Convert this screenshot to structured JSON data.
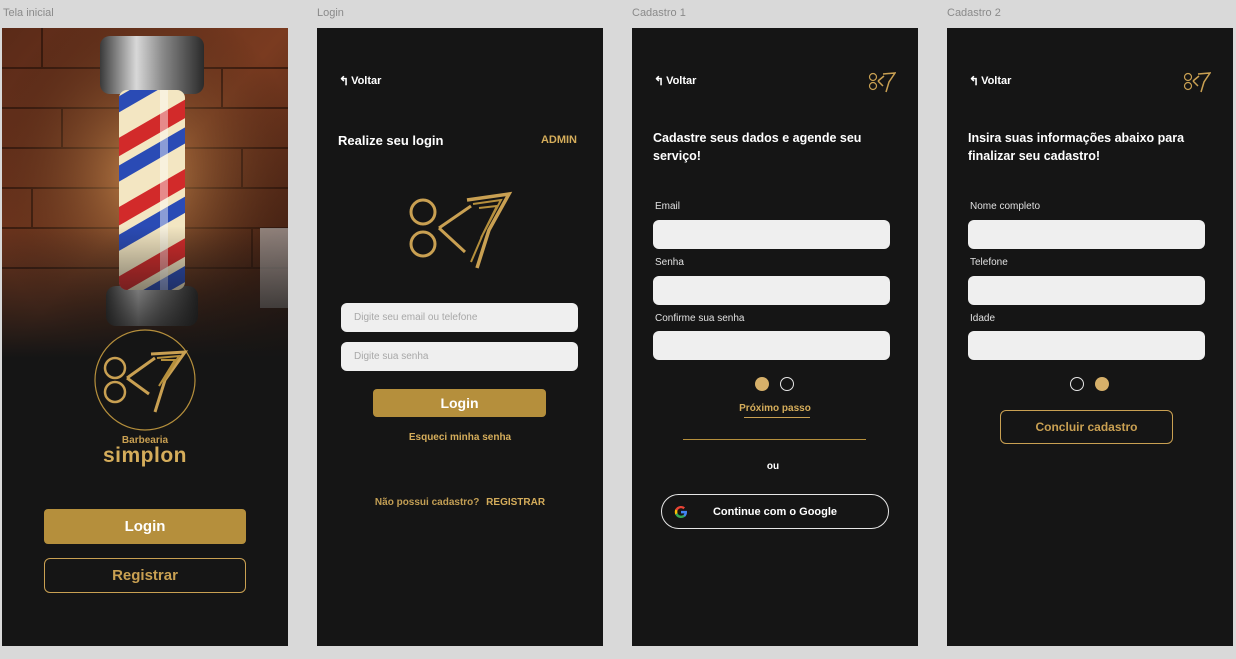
{
  "frames": {
    "tela_inicial": "Tela inicial",
    "login": "Login",
    "cadastro1": "Cadastro 1",
    "cadastro2": "Cadastro 2"
  },
  "colors": {
    "gold": "#b58f3c",
    "gold_light": "#d5ad5b",
    "bg": "#151515"
  },
  "splash": {
    "brand_top": "Barbearia",
    "brand_name": "simplon",
    "logo_text": "84",
    "login_button": "Login",
    "register_button": "Registrar"
  },
  "login": {
    "back": "Voltar",
    "title": "Realize seu login",
    "admin": "ADMIN",
    "email_placeholder": "Digite seu email ou telefone",
    "password_placeholder": "Digite sua senha",
    "login_button": "Login",
    "forgot": "Esqueci minha senha",
    "no_account": "Não possui cadastro?",
    "register": "REGISTRAR"
  },
  "cadastro1": {
    "back": "Voltar",
    "heading": "Cadastre seus dados e agende seu serviço!",
    "email_label": "Email",
    "password_label": "Senha",
    "confirm_label": "Confirme sua senha",
    "next": "Próximo passo",
    "or": "ou",
    "google_button": "Continue com o Google"
  },
  "cadastro2": {
    "back": "Voltar",
    "heading": "Insira suas informações abaixo para finalizar seu cadastro!",
    "name_label": "Nome completo",
    "phone_label": "Telefone",
    "age_label": "Idade",
    "finish_button": "Concluir cadastro"
  },
  "icons": [
    "back-arrow-icon",
    "brand-logo-icon",
    "google-icon",
    "step-dot-icon"
  ]
}
